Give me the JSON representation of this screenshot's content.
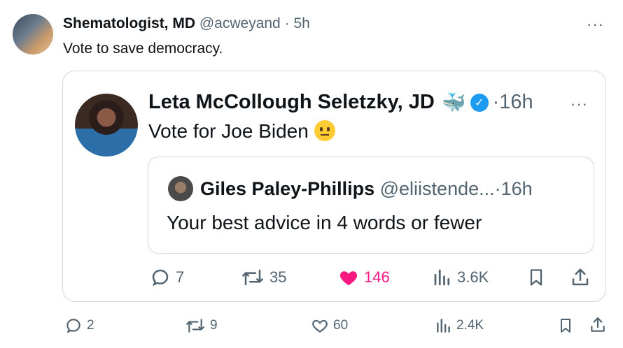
{
  "tweet": {
    "author_name": "Shematologist, MD",
    "handle": "@acweyand",
    "separator": "·",
    "time": "5h",
    "text": "Vote to save democracy.",
    "more": "···",
    "metrics": {
      "replies": "2",
      "reposts": "9",
      "likes": "60",
      "views": "2.4K"
    }
  },
  "quoted": {
    "author_name": "Leta McCollough Seletzky, JD",
    "badge_emoji": "🐳",
    "verified_mark": "✓",
    "time": "·16h",
    "text": "Vote for Joe Biden",
    "more": "···",
    "metrics": {
      "replies": "7",
      "reposts": "35",
      "likes": "146",
      "views": "3.6K"
    }
  },
  "nested": {
    "author_name": "Giles Paley-Phillips",
    "handle": "@eliistende...",
    "time": "·16h",
    "text": "Your best advice in 4 words or fewer"
  },
  "colors": {
    "like_active": "#f91880",
    "verified": "#1d9bf0",
    "muted": "#536471",
    "border": "#cfd9de"
  }
}
